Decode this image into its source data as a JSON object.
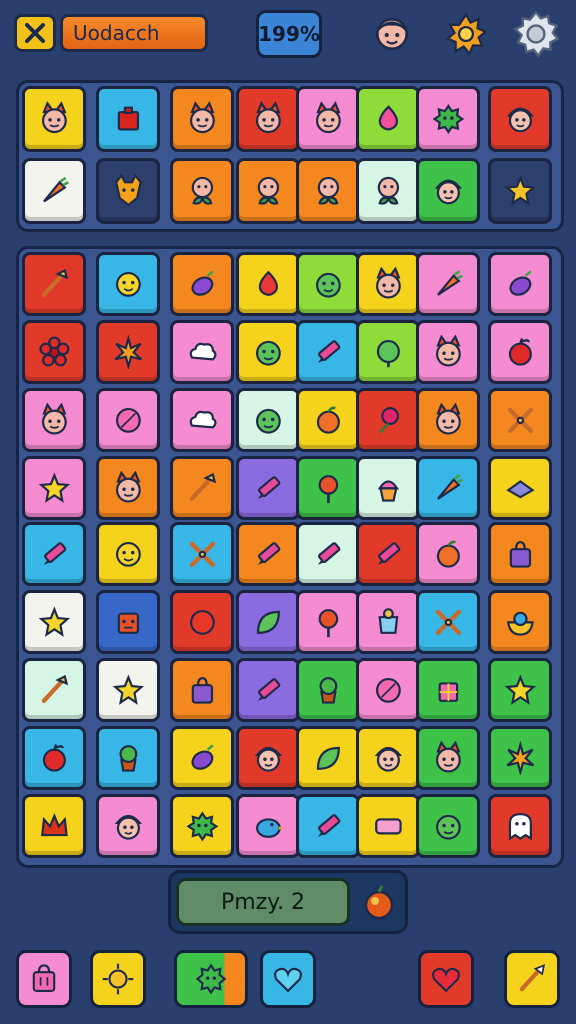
{
  "header": {
    "title": "Uodacch",
    "score": "199%"
  },
  "icons": {
    "close": "close-icon",
    "avatar": "avatar-icon",
    "sun": "sun-icon",
    "settings": "gear-icon"
  },
  "level": {
    "label": "Pmzy. 2"
  },
  "colors": {
    "background": "#2a3f6e",
    "accent": "#f68a2c",
    "score_bg": "#3c85d6",
    "level_bg": "#5f8c66"
  },
  "top_rows": [
    [
      "yellow:cat-face",
      "cyan:red-block",
      "orange:cat-face",
      "red:cat-face",
      "pink:cat-face",
      "lime:pink-drop",
      "pink:green-spiky",
      "red:face"
    ],
    [
      "white:carrot",
      "navy:fox-face",
      "orange:face-leaf",
      "orange:fox-leaf",
      "orange:cat-leaf",
      "mint:fox-leaf",
      "green:face",
      "navy:star"
    ]
  ],
  "main_rows": [
    [
      "red:brush",
      "cyan:yellow-face",
      "orange:eggplant",
      "yellow:red-drop",
      "lime:green-face",
      "yellow:cat-face",
      "pink:carrot",
      "pink:eggplant"
    ],
    [
      "red:red-flower",
      "red:star-burst",
      "pink:cloud",
      "yellow:green-face",
      "cyan:crayon",
      "lime:green-ball",
      "pink:cat-face",
      "pink:apple"
    ],
    [
      "pink:cat-face",
      "pink:pink-ball",
      "pink:cloud",
      "mint:green-face",
      "yellow:orange-fruit",
      "red:rose",
      "orange:cat-face",
      "orange:crossed"
    ],
    [
      "pink:yellow-star",
      "orange:cat-face",
      "orange:brush",
      "purple:crayon",
      "green:lollipop",
      "mint:cupcake",
      "cyan:carrot",
      "yellow:block"
    ],
    [
      "cyan:crayon",
      "yellow:yellow-face",
      "cyan:crossed",
      "orange:crayon",
      "mint:crayon",
      "red:crayon",
      "pink:orange-fruit",
      "orange:bag"
    ],
    [
      "white:yellow-star",
      "blue:robot",
      "red:red-ball",
      "purple:green-leaf",
      "pink:lollipop",
      "pink:cup",
      "cyan:crossed",
      "orange:bowl"
    ],
    [
      "mint:brush",
      "white:yellow-star",
      "orange:bag",
      "purple:crayon",
      "green:plant",
      "pink:pink-ball",
      "green:pink-gift",
      "green:yellow-star"
    ],
    [
      "cyan:apple",
      "cyan:plant",
      "yellow:eggplant",
      "red:face",
      "yellow:green-leaf",
      "yellow:face",
      "green:cat-face",
      "green:star-burst"
    ],
    [
      "yellow:crown",
      "pink:face",
      "yellow:green-spiky",
      "pink:bird",
      "cyan:crayon",
      "yellow:pink-block",
      "green:green-face",
      "red:ghost"
    ]
  ],
  "bottom_bar": [
    {
      "name": "shop-button",
      "icon": "bag-icon",
      "color": "pink"
    },
    {
      "name": "sun-button",
      "icon": "sun-icon",
      "color": "yellow"
    },
    {
      "name": "monster-button",
      "icon": "monster-icon",
      "color": "green"
    },
    {
      "name": "heart-button",
      "icon": "heart-icon",
      "color": "cyan"
    },
    {
      "name": "like-button",
      "icon": "heart-icon",
      "color": "red"
    },
    {
      "name": "brush-button",
      "icon": "brush-icon",
      "color": "yellow"
    }
  ]
}
